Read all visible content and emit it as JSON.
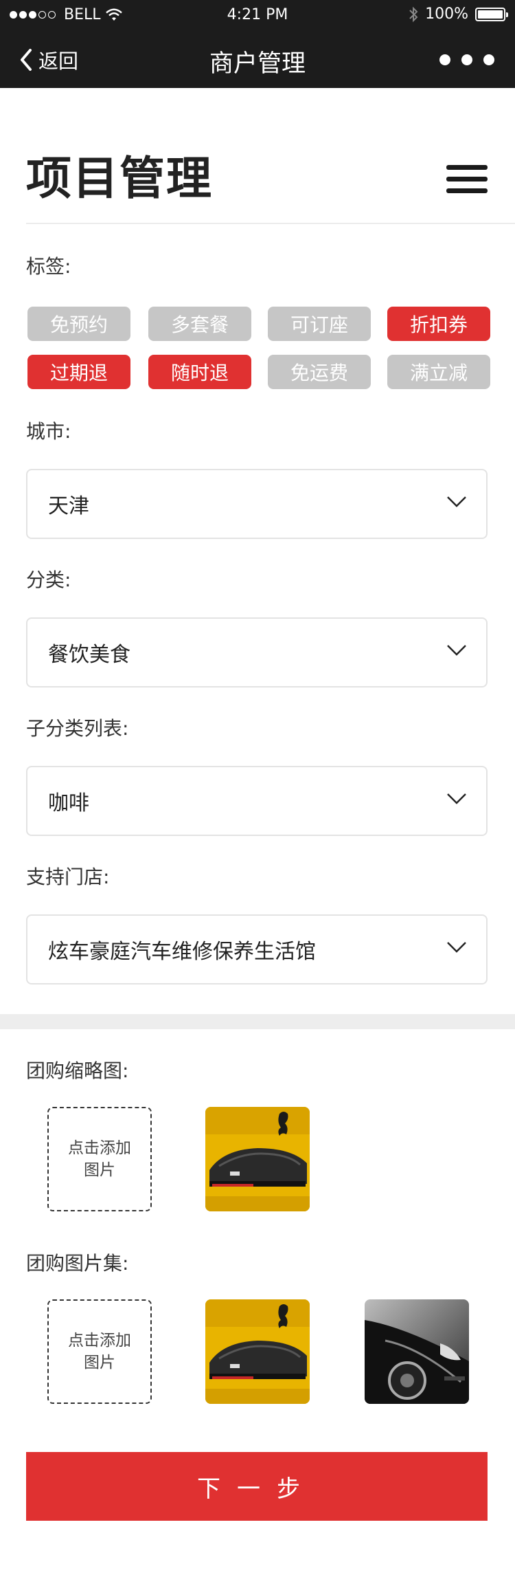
{
  "status_bar": {
    "carrier": "BELL",
    "time": "4:21 PM",
    "battery": "100%"
  },
  "nav": {
    "back_label": "返回",
    "title": "商户管理"
  },
  "header": {
    "title": "项目管理"
  },
  "tags": {
    "label": "标签:",
    "items": [
      {
        "label": "免预约",
        "selected": false
      },
      {
        "label": "多套餐",
        "selected": false
      },
      {
        "label": "可订座",
        "selected": false
      },
      {
        "label": "折扣券",
        "selected": true
      },
      {
        "label": "过期退",
        "selected": true
      },
      {
        "label": "随时退",
        "selected": true
      },
      {
        "label": "免运费",
        "selected": false
      },
      {
        "label": "满立减",
        "selected": false
      }
    ]
  },
  "city": {
    "label": "城市:",
    "value": "天津"
  },
  "category": {
    "label": "分类:",
    "value": "餐饮美食"
  },
  "subcategory": {
    "label": "子分类列表:",
    "value": "咖啡"
  },
  "store": {
    "label": "支持门店:",
    "value": "炫车豪庭汽车维修保养生活馆"
  },
  "thumbnail": {
    "label": "团购缩略图:",
    "add_label_1": "点击添加",
    "add_label_2": "图片"
  },
  "gallery": {
    "label": "团购图片集:",
    "add_label_1": "点击添加",
    "add_label_2": "图片"
  },
  "next_button": {
    "label": "下一步"
  },
  "colors": {
    "accent": "#e03131",
    "tag_off": "#c6c6c6",
    "nav_bg": "#1c1c1c"
  }
}
